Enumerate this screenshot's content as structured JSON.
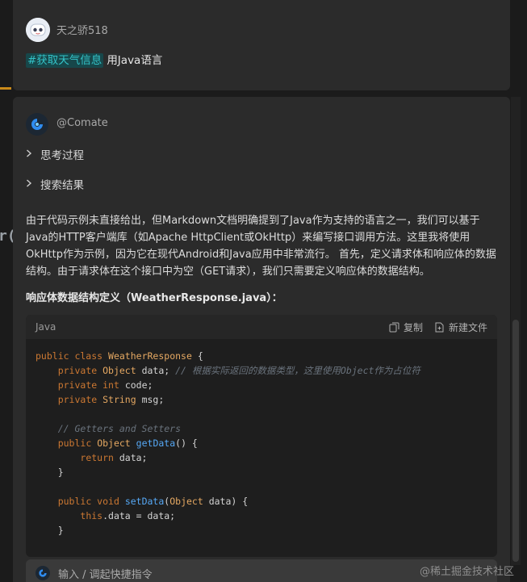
{
  "user": {
    "name": "天之骄518",
    "prompt_tag": "#获取天气信息",
    "prompt_text": "用Java语言"
  },
  "bot": {
    "name": "@Comate",
    "collapsibles": [
      "思考过程",
      "搜索结果"
    ],
    "paragraph": "由于代码示例未直接给出，但Markdown文档明确提到了Java作为支持的语言之一，我们可以基于Java的HTTP客户端库（如Apache HttpClient或OkHttp）来编写接口调用方法。这里我将使用OkHttp作为示例，因为它在现代Android和Java应用中非常流行。 首先，定义请求体和响应体的数据结构。由于请求体在这个接口中为空（GET请求），我们只需要定义响应体的数据结构。",
    "section_title": "响应体数据结构定义（WeatherResponse.java）："
  },
  "code_block": {
    "language": "Java",
    "copy_label": "复制",
    "new_file_label": "新建文件"
  },
  "input": {
    "placeholder": "输入 / 调起快捷指令"
  },
  "watermark": "@稀土掘金技术社区",
  "left_glyph": "r(",
  "colors": {
    "panel": "#2b2b2b",
    "background": "#1b1b1b",
    "tag": "#33c3c8",
    "accent": "#c98a1a"
  }
}
